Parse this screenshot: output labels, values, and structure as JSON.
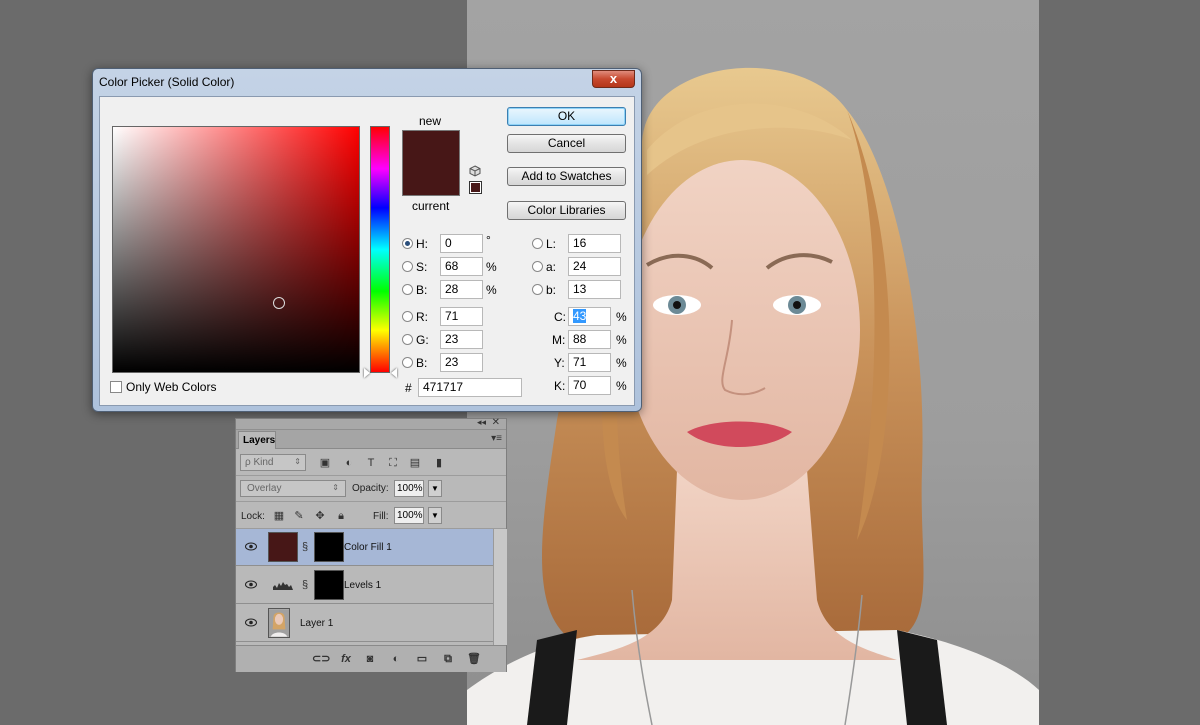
{
  "colors": {
    "workspace_bg": "#6b6b6b",
    "picked_color": "#471717",
    "current_color": "#471717",
    "dialog_frame": "#aec2dc",
    "layer_active": "#a6b7d6"
  },
  "color_picker": {
    "title": "Color Picker (Solid Color)",
    "close_glyph": "x",
    "new_label": "new",
    "current_label": "current",
    "buttons": {
      "ok": "OK",
      "cancel": "Cancel",
      "add_to_swatches": "Add to Swatches",
      "color_libraries": "Color Libraries"
    },
    "fields": {
      "H": {
        "label": "H:",
        "value": "0",
        "unit": "°",
        "selected": true
      },
      "S": {
        "label": "S:",
        "value": "68",
        "unit": "%"
      },
      "B": {
        "label": "B:",
        "value": "28",
        "unit": "%"
      },
      "R": {
        "label": "R:",
        "value": "71"
      },
      "G": {
        "label": "G:",
        "value": "23"
      },
      "Bl": {
        "label": "B:",
        "value": "23"
      },
      "L": {
        "label": "L:",
        "value": "16"
      },
      "a": {
        "label": "a:",
        "value": "24"
      },
      "b": {
        "label": "b:",
        "value": "13"
      },
      "C": {
        "label": "C:",
        "value": "43",
        "unit": "%"
      },
      "M": {
        "label": "M:",
        "value": "88",
        "unit": "%"
      },
      "Y": {
        "label": "Y:",
        "value": "71",
        "unit": "%"
      },
      "K": {
        "label": "K:",
        "value": "70",
        "unit": "%"
      }
    },
    "only_web_colors_label": "Only Web Colors",
    "only_web_colors_checked": false,
    "hex_label": "#",
    "hex_value": "471717"
  },
  "layers_panel": {
    "tab_label": "Layers",
    "collapse_glyph": "◂◂",
    "close_glyph": "✕",
    "menu_glyph": "▾≡",
    "filter_kind": "ρ Kind",
    "blend_mode": "Overlay",
    "opacity_label": "Opacity:",
    "opacity_value": "100%",
    "lock_label": "Lock:",
    "fill_label": "Fill:",
    "fill_value": "100%",
    "layers": [
      {
        "name": "Color Fill 1",
        "active": true,
        "visible": true
      },
      {
        "name": "Levels 1",
        "active": false,
        "visible": true
      },
      {
        "name": "Layer 1",
        "active": false,
        "visible": true
      }
    ],
    "footer_fx": "fx"
  }
}
